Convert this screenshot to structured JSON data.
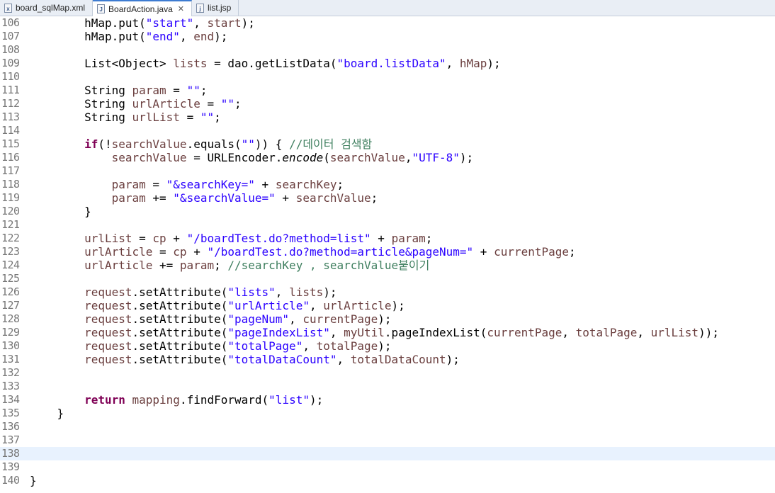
{
  "tabs": [
    {
      "label": "board_sqlMap.xml",
      "icon": "xml-file-icon",
      "active": false
    },
    {
      "label": "BoardAction.java",
      "icon": "java-file-icon",
      "active": true,
      "close": "✕"
    },
    {
      "label": "list.jsp",
      "icon": "jsp-file-icon",
      "active": false
    }
  ],
  "editor": {
    "current_line": 138,
    "lines": [
      {
        "n": "106",
        "tokens": [
          [
            "",
            "        hMap.put("
          ],
          [
            "str",
            "\"start\""
          ],
          [
            "",
            ", "
          ],
          [
            "var",
            "start"
          ],
          [
            "",
            ");"
          ]
        ]
      },
      {
        "n": "107",
        "tokens": [
          [
            "",
            "        hMap.put("
          ],
          [
            "str",
            "\"end\""
          ],
          [
            "",
            ", "
          ],
          [
            "var",
            "end"
          ],
          [
            "",
            ");"
          ]
        ]
      },
      {
        "n": "108",
        "tokens": []
      },
      {
        "n": "109",
        "tokens": [
          [
            "",
            "        List<Object> "
          ],
          [
            "var",
            "lists"
          ],
          [
            "",
            " = dao.getListData("
          ],
          [
            "str",
            "\"board.listData\""
          ],
          [
            "",
            ", "
          ],
          [
            "var",
            "hMap"
          ],
          [
            "",
            ");"
          ]
        ]
      },
      {
        "n": "110",
        "tokens": []
      },
      {
        "n": "111",
        "tokens": [
          [
            "",
            "        String "
          ],
          [
            "var",
            "param"
          ],
          [
            "",
            " = "
          ],
          [
            "str",
            "\"\""
          ],
          [
            "",
            ";"
          ]
        ]
      },
      {
        "n": "112",
        "tokens": [
          [
            "",
            "        String "
          ],
          [
            "var",
            "urlArticle"
          ],
          [
            "",
            " = "
          ],
          [
            "str",
            "\"\""
          ],
          [
            "",
            ";"
          ]
        ]
      },
      {
        "n": "113",
        "tokens": [
          [
            "",
            "        String "
          ],
          [
            "var",
            "urlList"
          ],
          [
            "",
            " = "
          ],
          [
            "str",
            "\"\""
          ],
          [
            "",
            ";"
          ]
        ]
      },
      {
        "n": "114",
        "tokens": []
      },
      {
        "n": "115",
        "tokens": [
          [
            "",
            "        "
          ],
          [
            "kw",
            "if"
          ],
          [
            "",
            "(!"
          ],
          [
            "var",
            "searchValue"
          ],
          [
            "",
            ".equals("
          ],
          [
            "str",
            "\"\""
          ],
          [
            "",
            ")) { "
          ],
          [
            "cm",
            "//데이터 검색함"
          ]
        ]
      },
      {
        "n": "116",
        "tokens": [
          [
            "",
            "            "
          ],
          [
            "var",
            "searchValue"
          ],
          [
            "",
            " = URLEncoder."
          ],
          [
            "it",
            "encode"
          ],
          [
            "",
            "("
          ],
          [
            "var",
            "searchValue"
          ],
          [
            "",
            ","
          ],
          [
            "str",
            "\"UTF-8\""
          ],
          [
            "",
            ");"
          ]
        ]
      },
      {
        "n": "117",
        "tokens": []
      },
      {
        "n": "118",
        "tokens": [
          [
            "",
            "            "
          ],
          [
            "var",
            "param"
          ],
          [
            "",
            " = "
          ],
          [
            "str",
            "\"&searchKey=\""
          ],
          [
            "",
            " + "
          ],
          [
            "var",
            "searchKey"
          ],
          [
            "",
            ";"
          ]
        ]
      },
      {
        "n": "119",
        "tokens": [
          [
            "",
            "            "
          ],
          [
            "var",
            "param"
          ],
          [
            "",
            " += "
          ],
          [
            "str",
            "\"&searchValue=\""
          ],
          [
            "",
            " + "
          ],
          [
            "var",
            "searchValue"
          ],
          [
            "",
            ";"
          ]
        ]
      },
      {
        "n": "120",
        "tokens": [
          [
            "",
            "        }"
          ]
        ]
      },
      {
        "n": "121",
        "tokens": []
      },
      {
        "n": "122",
        "tokens": [
          [
            "",
            "        "
          ],
          [
            "var",
            "urlList"
          ],
          [
            "",
            " = "
          ],
          [
            "var",
            "cp"
          ],
          [
            "",
            " + "
          ],
          [
            "str",
            "\"/boardTest.do?method=list\""
          ],
          [
            "",
            " + "
          ],
          [
            "var",
            "param"
          ],
          [
            "",
            ";"
          ]
        ]
      },
      {
        "n": "123",
        "tokens": [
          [
            "",
            "        "
          ],
          [
            "var",
            "urlArticle"
          ],
          [
            "",
            " = "
          ],
          [
            "var",
            "cp"
          ],
          [
            "",
            " + "
          ],
          [
            "str",
            "\"/boardTest.do?method=article&pageNum=\""
          ],
          [
            "",
            " + "
          ],
          [
            "var",
            "currentPage"
          ],
          [
            "",
            ";"
          ]
        ]
      },
      {
        "n": "124",
        "tokens": [
          [
            "",
            "        "
          ],
          [
            "var",
            "urlArticle"
          ],
          [
            "",
            " += "
          ],
          [
            "var",
            "param"
          ],
          [
            "",
            "; "
          ],
          [
            "cm",
            "//searchKey , searchValue붙이기"
          ]
        ]
      },
      {
        "n": "125",
        "tokens": []
      },
      {
        "n": "126",
        "tokens": [
          [
            "",
            "        "
          ],
          [
            "var",
            "request"
          ],
          [
            "",
            ".setAttribute("
          ],
          [
            "str",
            "\"lists\""
          ],
          [
            "",
            ", "
          ],
          [
            "var",
            "lists"
          ],
          [
            "",
            ");"
          ]
        ]
      },
      {
        "n": "127",
        "tokens": [
          [
            "",
            "        "
          ],
          [
            "var",
            "request"
          ],
          [
            "",
            ".setAttribute("
          ],
          [
            "str",
            "\"urlArticle\""
          ],
          [
            "",
            ", "
          ],
          [
            "var",
            "urlArticle"
          ],
          [
            "",
            ");"
          ]
        ]
      },
      {
        "n": "128",
        "tokens": [
          [
            "",
            "        "
          ],
          [
            "var",
            "request"
          ],
          [
            "",
            ".setAttribute("
          ],
          [
            "str",
            "\"pageNum\""
          ],
          [
            "",
            ", "
          ],
          [
            "var",
            "currentPage"
          ],
          [
            "",
            ");"
          ]
        ]
      },
      {
        "n": "129",
        "tokens": [
          [
            "",
            "        "
          ],
          [
            "var",
            "request"
          ],
          [
            "",
            ".setAttribute("
          ],
          [
            "str",
            "\"pageIndexList\""
          ],
          [
            "",
            ", "
          ],
          [
            "var",
            "myUtil"
          ],
          [
            "",
            ".pageIndexList("
          ],
          [
            "var",
            "currentPage"
          ],
          [
            "",
            ", "
          ],
          [
            "var",
            "totalPage"
          ],
          [
            "",
            ", "
          ],
          [
            "var",
            "urlList"
          ],
          [
            "",
            "));"
          ]
        ]
      },
      {
        "n": "130",
        "tokens": [
          [
            "",
            "        "
          ],
          [
            "var",
            "request"
          ],
          [
            "",
            ".setAttribute("
          ],
          [
            "str",
            "\"totalPage\""
          ],
          [
            "",
            ", "
          ],
          [
            "var",
            "totalPage"
          ],
          [
            "",
            ");"
          ]
        ]
      },
      {
        "n": "131",
        "tokens": [
          [
            "",
            "        "
          ],
          [
            "var",
            "request"
          ],
          [
            "",
            ".setAttribute("
          ],
          [
            "str",
            "\"totalDataCount\""
          ],
          [
            "",
            ", "
          ],
          [
            "var",
            "totalDataCount"
          ],
          [
            "",
            ");"
          ]
        ]
      },
      {
        "n": "132",
        "tokens": []
      },
      {
        "n": "133",
        "tokens": []
      },
      {
        "n": "134",
        "tokens": [
          [
            "",
            "        "
          ],
          [
            "kw",
            "return"
          ],
          [
            "",
            " "
          ],
          [
            "var",
            "mapping"
          ],
          [
            "",
            ".findForward("
          ],
          [
            "str",
            "\"list\""
          ],
          [
            "",
            ");"
          ]
        ]
      },
      {
        "n": "135",
        "tokens": [
          [
            "",
            "    }"
          ]
        ]
      },
      {
        "n": "136",
        "tokens": []
      },
      {
        "n": "137",
        "tokens": []
      },
      {
        "n": "138",
        "tokens": []
      },
      {
        "n": "139",
        "tokens": []
      },
      {
        "n": "140",
        "tokens": [
          [
            "",
            "}"
          ]
        ]
      }
    ]
  }
}
